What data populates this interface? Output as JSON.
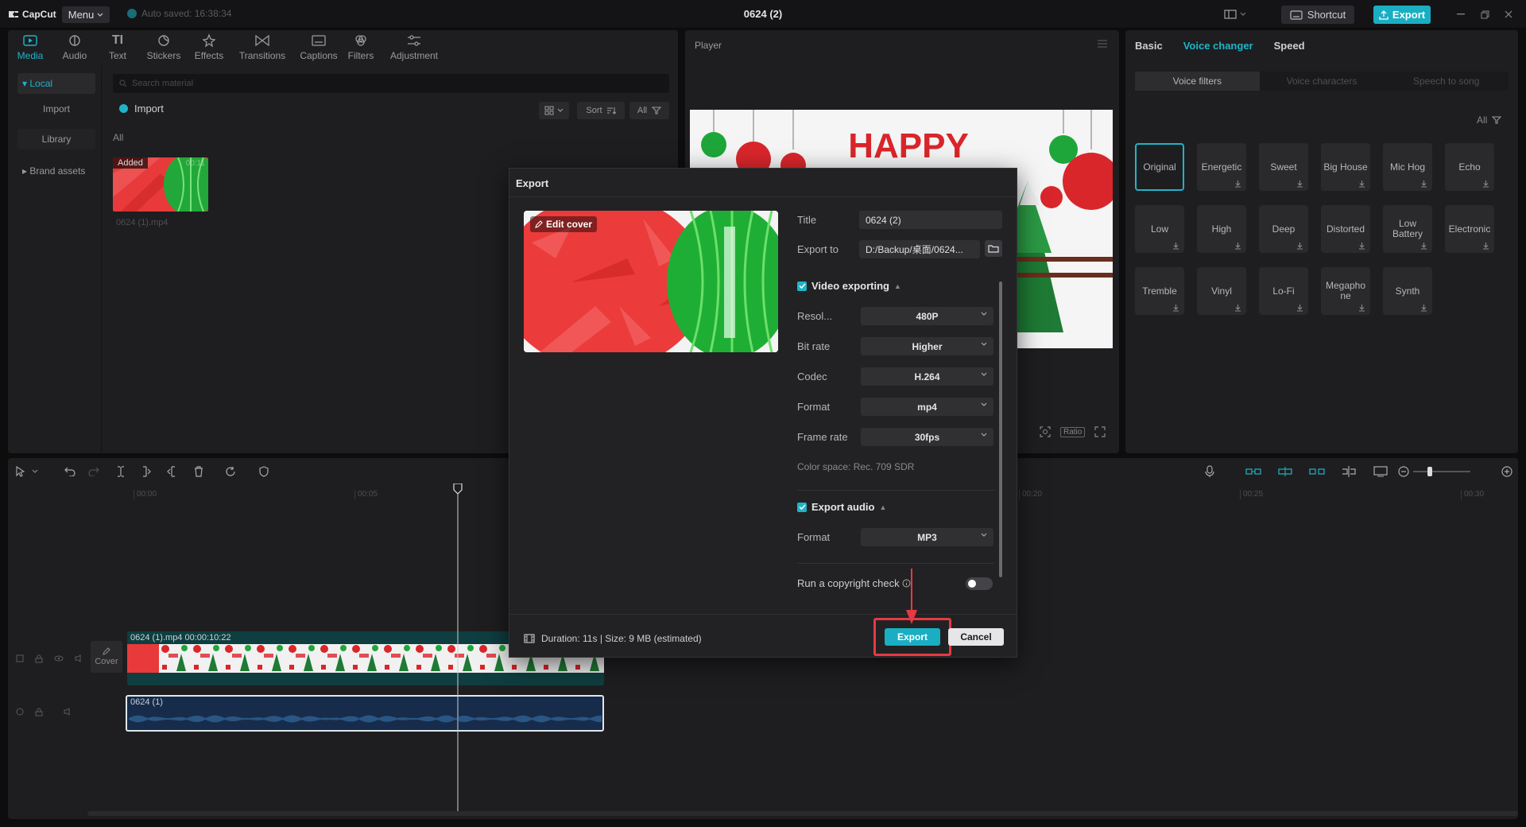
{
  "app": {
    "logo": "CapCut",
    "menu_label": "Menu",
    "autosave": "Auto saved: 16:38:34",
    "project_title": "0624 (2)",
    "shortcut_label": "Shortcut",
    "export_label": "Export",
    "accent_color": "#1aaec3"
  },
  "tools": [
    {
      "label": "Media",
      "icon": "media-icon"
    },
    {
      "label": "Audio",
      "icon": "audio-icon"
    },
    {
      "label": "Text",
      "icon": "text-icon"
    },
    {
      "label": "Stickers",
      "icon": "sticker-icon"
    },
    {
      "label": "Effects",
      "icon": "effects-icon"
    },
    {
      "label": "Transitions",
      "icon": "transitions-icon"
    },
    {
      "label": "Captions",
      "icon": "captions-icon"
    },
    {
      "label": "Filters",
      "icon": "filters-icon"
    },
    {
      "label": "Adjustment",
      "icon": "adjustment-icon"
    }
  ],
  "media": {
    "sidebar": [
      "Local",
      "Import",
      "Library",
      "Brand assets"
    ],
    "search_placeholder": "Search material",
    "import_label": "Import",
    "sort_label": "Sort",
    "filter_label": "All",
    "all_label": "All",
    "clip_badge": "Added",
    "clip_duration": "00:11",
    "clip_name": "0624 (1).mp4"
  },
  "player": {
    "title": "Player",
    "video_text": "HAPPY",
    "ratio_label": "Ratio"
  },
  "right_panel": {
    "tabs": [
      "Basic",
      "Voice changer",
      "Speed"
    ],
    "subtabs": [
      "Voice filters",
      "Voice characters",
      "Speech to song"
    ],
    "filter_all": "All",
    "voice_filters": [
      [
        "Original",
        "Energetic",
        "Sweet",
        "Big House",
        "Mic Hog",
        "Echo"
      ],
      [
        "Low",
        "High",
        "Deep",
        "Distorted",
        "Low Battery",
        "Electronic"
      ],
      [
        "Tremble",
        "Vinyl",
        "Lo-Fi",
        "Megapho ne",
        "Synth"
      ]
    ]
  },
  "timeline": {
    "ticks": [
      "00:00",
      "00:05",
      "00:20",
      "00:25",
      "00:30"
    ],
    "video_clip_label": "0624 (1).mp4   00:00:10:22",
    "audio_clip_label": "0624 (1)",
    "cover_label": "Cover"
  },
  "export_dialog": {
    "title": "Export",
    "edit_cover_label": "Edit cover",
    "title_label": "Title",
    "title_value": "0624 (2)",
    "export_to_label": "Export to",
    "export_to_value": "D:/Backup/桌面/0624...",
    "video_section": "Video exporting",
    "resolution_label": "Resol...",
    "resolution_value": "480P",
    "bitrate_label": "Bit rate",
    "bitrate_value": "Higher",
    "codec_label": "Codec",
    "codec_value": "H.264",
    "format_label": "Format",
    "format_value": "mp4",
    "framerate_label": "Frame rate",
    "framerate_value": "30fps",
    "color_space": "Color space: Rec. 709 SDR",
    "audio_section": "Export audio",
    "audio_format_label": "Format",
    "audio_format_value": "MP3",
    "copyright_label": "Run a copyright check",
    "duration_info": "Duration: 11s | Size: 9 MB (estimated)",
    "export_button": "Export",
    "cancel_button": "Cancel",
    "highlight_color": "#e53a43"
  }
}
